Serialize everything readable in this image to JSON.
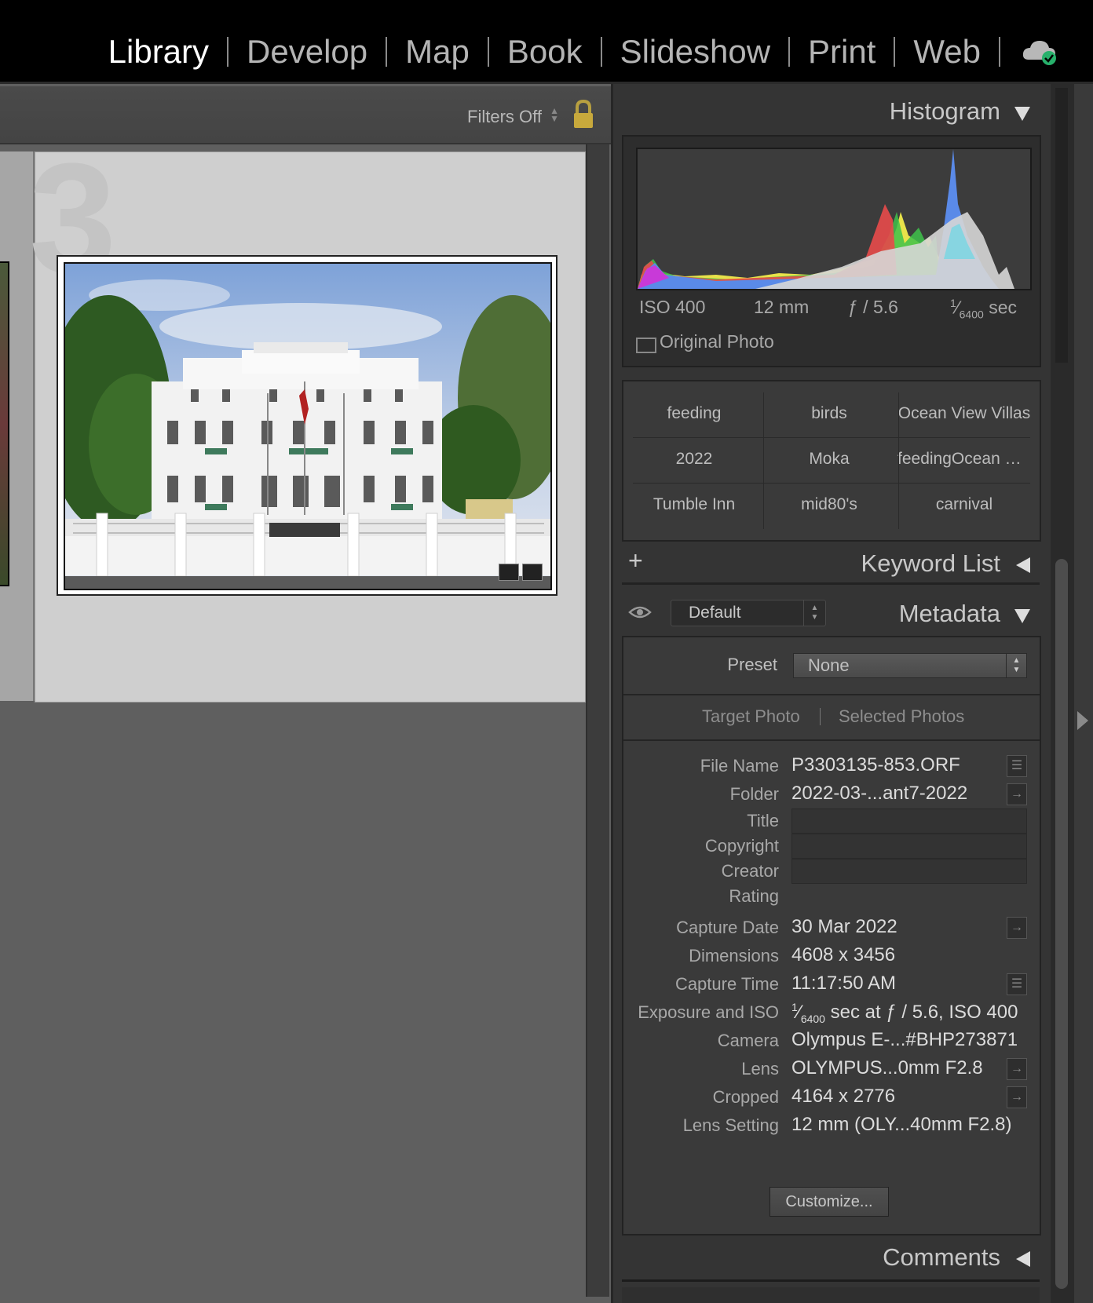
{
  "modules": {
    "items": [
      {
        "label": "Library",
        "active": true
      },
      {
        "label": "Develop",
        "active": false
      },
      {
        "label": "Map",
        "active": false
      },
      {
        "label": "Book",
        "active": false
      },
      {
        "label": "Slideshow",
        "active": false
      },
      {
        "label": "Print",
        "active": false
      },
      {
        "label": "Web",
        "active": false
      }
    ],
    "sync_icon": "cloud-sync-check-icon"
  },
  "filterbar": {
    "label": "Filters Off",
    "lock_icon": "lock-icon"
  },
  "grid": {
    "cell_index": "3",
    "thumbnail_icon": "photo-thumbnail"
  },
  "histogram": {
    "title": "Histogram",
    "iso": "ISO 400",
    "focal": "12 mm",
    "aperture": "ƒ / 5.6",
    "shutter_num": "1",
    "shutter_den": "6400",
    "shutter_unit": "sec",
    "original_photo": "Original Photo"
  },
  "keywords": {
    "items": [
      "feeding",
      "birds",
      "Ocean View Villas",
      "2022",
      "Moka",
      "feedingOcean View...",
      "Tumble Inn",
      "mid80's",
      "carnival"
    ]
  },
  "keyword_list": {
    "title": "Keyword List",
    "add": "+"
  },
  "metadata": {
    "title": "Metadata",
    "view": "Default",
    "preset_label": "Preset",
    "preset_value": "None",
    "target_photo": "Target Photo",
    "selected_photos": "Selected Photos",
    "rows": [
      {
        "label": "File Name",
        "value": "P3303135-853.ORF"
      },
      {
        "label": "Folder",
        "value": "2022-03-...ant7-2022"
      },
      {
        "label": "Title",
        "value": ""
      },
      {
        "label": "Copyright",
        "value": ""
      },
      {
        "label": "Creator",
        "value": ""
      },
      {
        "label": "Rating",
        "value": ""
      },
      {
        "label": "Capture Date",
        "value": "30 Mar 2022"
      },
      {
        "label": "Dimensions",
        "value": "4608 x 3456"
      },
      {
        "label": "Capture Time",
        "value": "11:17:50 AM"
      },
      {
        "label": "Exposure and ISO",
        "value_pre": "1",
        "value_den": "6400",
        "value_post": " sec at ƒ / 5.6, ISO 400"
      },
      {
        "label": "Camera",
        "value": "Olympus E-...#BHP273871"
      },
      {
        "label": "Lens",
        "value": "OLYMPUS...0mm F2.8"
      },
      {
        "label": "Cropped",
        "value": "4164 x 2776"
      },
      {
        "label": "Lens Setting",
        "value": "12 mm (OLY...40mm F2.8)"
      }
    ],
    "customize": "Customize..."
  },
  "comments": {
    "title": "Comments"
  }
}
